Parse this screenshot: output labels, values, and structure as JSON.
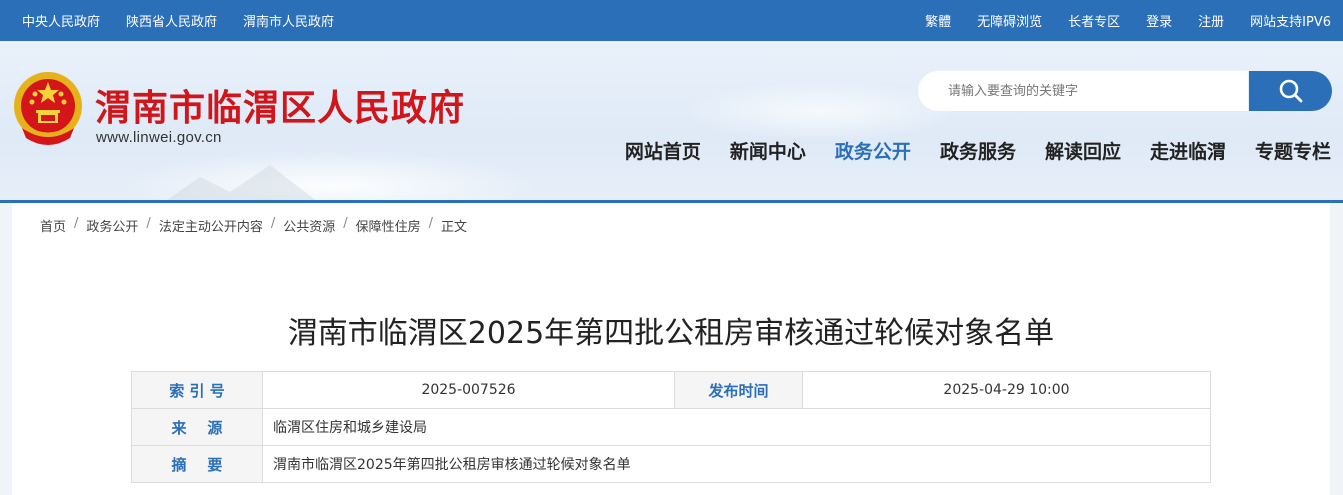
{
  "topbar": {
    "left_links": [
      "中央人民政府",
      "陕西省人民政府",
      "渭南市人民政府"
    ],
    "right_links": [
      "繁體",
      "无障碍浏览",
      "长者专区",
      "登录",
      "注册",
      "网站支持IPV6"
    ]
  },
  "header": {
    "site_name": "渭南市临渭区人民政府",
    "site_url": "www.linwei.gov.cn",
    "emblem_icon": "national-emblem-icon",
    "search": {
      "placeholder": "请输入要查询的关键字",
      "icon": "search-icon"
    },
    "nav": [
      "网站首页",
      "新闻中心",
      "政务公开",
      "政务服务",
      "解读回应",
      "走进临渭",
      "专题专栏"
    ],
    "active_nav": "政务公开"
  },
  "breadcrumb": [
    "首页",
    "政务公开",
    "法定主动公开内容",
    "公共资源",
    "保障性住房",
    "正文"
  ],
  "article": {
    "title": "渭南市临渭区2025年第四批公租房审核通过轮候对象名单"
  },
  "meta": {
    "index_label": "索 引 号",
    "index_value": "2025-007526",
    "date_label": "发布时间",
    "date_value": "2025-04-29 10:00",
    "source_label": "来    源",
    "source_value": "临渭区住房和城乡建设局",
    "summary_label": "摘    要",
    "summary_value": "渭南市临渭区2025年第四批公租房审核通过轮候对象名单"
  },
  "colors": {
    "primary_blue": "#2b6fb8",
    "site_name_red": "#d0161b",
    "label_bg": "#f5f5f5"
  }
}
